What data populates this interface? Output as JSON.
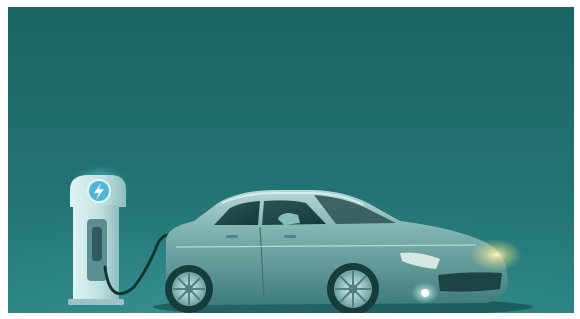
{
  "scene": {
    "subject": "",
    "colors": {
      "background_top": "#1b6465",
      "background_bottom": "#2c8686",
      "glow": "#7fe6ff",
      "headlight": "#fff1a8"
    },
    "icons": {
      "charger_badge": "lightning-bolt-icon"
    }
  }
}
